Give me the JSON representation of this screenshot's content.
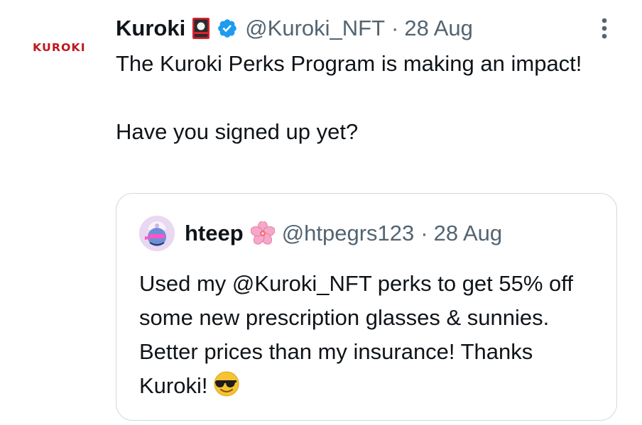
{
  "tweet": {
    "brand_logo_text": "KUROKI",
    "author_name": "Kuroki",
    "handle": "@Kuroki_NFT",
    "separator": "·",
    "date": "28 Aug",
    "body_line1": "The Kuroki Perks Program is making an impact!",
    "body_line2": "Have you signed up yet?",
    "icons": {
      "flag": "hanafuda-card-icon",
      "verified": "verified-badge-icon",
      "more": "more-options-icon"
    }
  },
  "quote": {
    "author_name": "hteep",
    "handle": "@htpegrs123",
    "separator": "·",
    "date": "28 Aug",
    "text": "Used my @Kuroki_NFT perks to get 55% off some new prescription glasses & sunnies.  Better prices than my insurance!  Thanks Kuroki!",
    "icons": {
      "badge": "cherry-blossom-icon",
      "emoji": "sunglasses-face-emoji"
    }
  },
  "colors": {
    "text": "#0f1419",
    "secondary": "#536471",
    "verified": "#1d9bf0",
    "brand": "#c0161c",
    "border": "#cfd9de"
  }
}
